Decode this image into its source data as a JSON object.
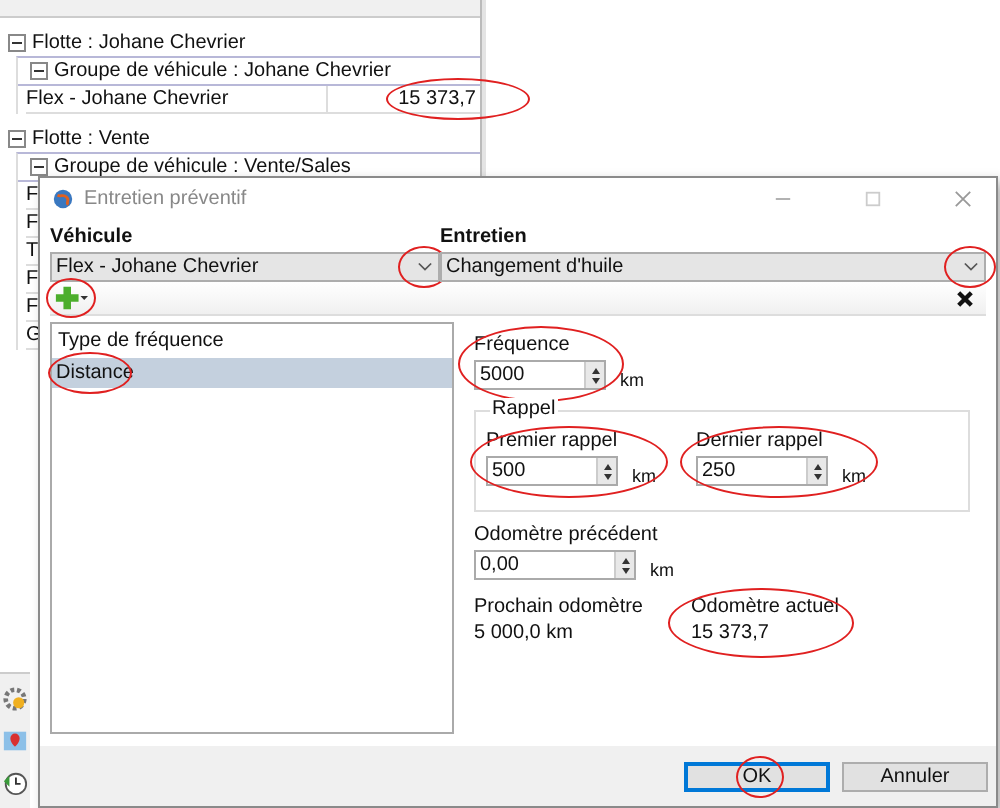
{
  "background": {
    "groups": [
      {
        "label": "Flotte : Johane Chevrier",
        "expanded": true,
        "subgroups": [
          {
            "label": "Groupe de véhicule : Johane Chevrier",
            "expanded": true,
            "rows": [
              {
                "name": "Flex - Johane Chevrier",
                "odometer": "15 373,7",
                "highlighted": true
              }
            ]
          }
        ]
      },
      {
        "label": "Flotte : Vente",
        "expanded": true,
        "subgroups": [
          {
            "label": "Groupe de véhicule : Vente/Sales",
            "expanded": true,
            "rows": [
              {
                "name": "F"
              },
              {
                "name": "F"
              },
              {
                "name": "T"
              },
              {
                "name": "F"
              },
              {
                "name": "F"
              },
              {
                "name": "G"
              }
            ]
          }
        ]
      }
    ]
  },
  "dialog": {
    "title": "Entretien préventif",
    "vehicle": {
      "label": "Véhicule",
      "value": "Flex - Johane Chevrier",
      "highlighted": true
    },
    "maintenance": {
      "label": "Entretien",
      "value": "Changement d'huile",
      "highlighted": true
    },
    "add_button": {
      "highlighted": true
    },
    "frequency_list": {
      "header": "Type de fréquence",
      "items": [
        {
          "label": "Distance",
          "selected": true,
          "highlighted": true
        }
      ]
    },
    "frequency": {
      "label": "Fréquence",
      "value": "5000",
      "unit": "km",
      "highlighted": true
    },
    "reminder": {
      "title": "Rappel",
      "first": {
        "label": "Premier rappel",
        "value": "500",
        "unit": "km",
        "highlighted": true
      },
      "last": {
        "label": "Dernier rappel",
        "value": "250",
        "unit": "km",
        "highlighted": true
      }
    },
    "previous_odometer": {
      "label": "Odomètre précédent",
      "value": "0,00",
      "unit": "km"
    },
    "next_odometer": {
      "label": "Prochain odomètre",
      "value": "5 000,0 km"
    },
    "current_odometer": {
      "label": "Odomètre actuel",
      "value": "15 373,7",
      "highlighted": true
    },
    "buttons": [
      {
        "label": "OK",
        "default": true,
        "highlighted": true
      },
      {
        "label": "Annuler",
        "default": false,
        "highlighted": false
      }
    ]
  }
}
